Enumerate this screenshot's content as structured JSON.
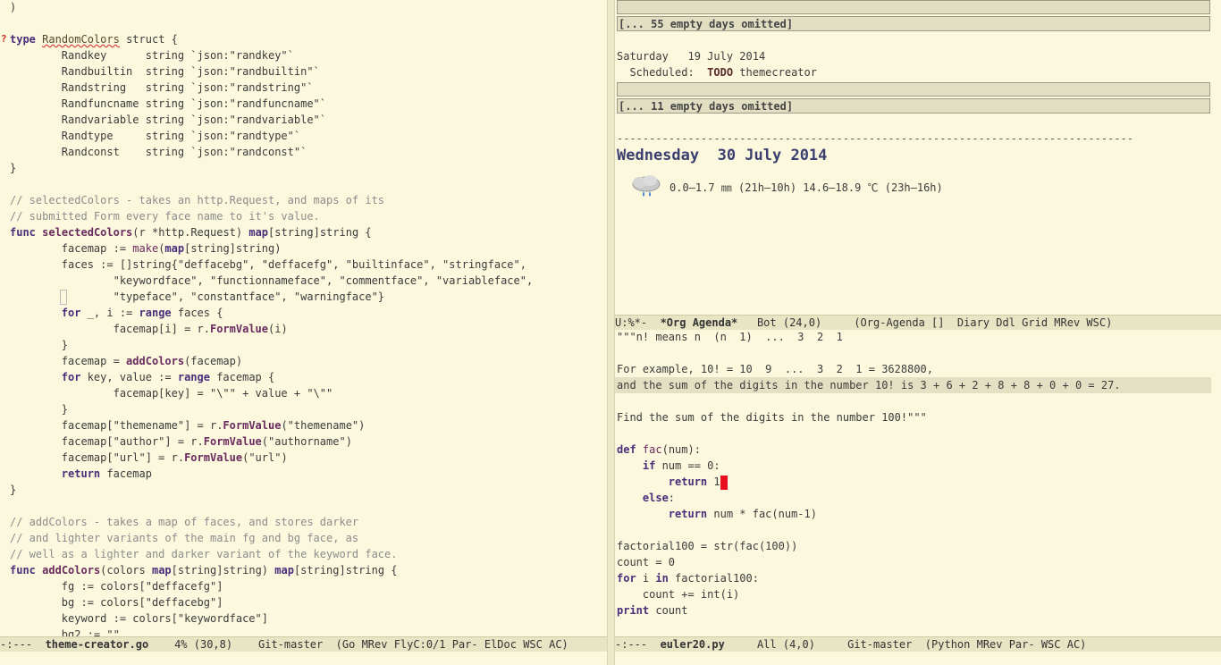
{
  "left": {
    "lines": [
      ")",
      "",
      "",
      "        Randkey      string `json:\"randkey\"`",
      "        Randbuiltin  string `json:\"randbuiltin\"`",
      "        Randstring   string `json:\"randstring\"`",
      "        Randfuncname string `json:\"randfuncname\"`",
      "        Randvariable string `json:\"randvariable\"`",
      "        Randtype     string `json:\"randtype\"`",
      "        Randconst    string `json:\"randconst\"`",
      "}",
      ""
    ],
    "struct_kw": "type",
    "struct_name": "RandomColors",
    "struct_rest": " struct {",
    "c1": "// selectedColors - takes an http.Request, and maps of its",
    "c2": "// submitted Form every face name to it's value.",
    "l_func1_kw": "func",
    "l_func1_name": "selectedColors",
    "l_func1_a": "(r *http.Request) ",
    "l_func1_map": "map",
    "l_func1_b": "[string]string {",
    "l_fm1_a": "        facemap := ",
    "l_fm1_make": "make",
    "l_fm1_b": "(",
    "l_fm1_map": "map",
    "l_fm1_c": "[string]string)",
    "l_faces1": "        faces := []string{\"deffacebg\", \"deffacefg\", \"builtinface\", \"stringface\",",
    "l_faces2": "                \"keywordface\", \"functionnameface\", \"commentface\", \"variableface\",",
    "l_faces3": "                \"typeface\", \"constantface\", \"warningface\"}",
    "l_for1_kw": "for",
    "l_for1_a": " _, i := ",
    "l_for1_range": "range",
    "l_for1_b": " faces {",
    "l_fmi_a": "                facemap[i] = r.",
    "l_fmi_fn": "FormValue",
    "l_fmi_b": "(i)",
    "l_close1": "        }",
    "l_fmadd_a": "        facemap = ",
    "l_fmadd_fn": "addColors",
    "l_fmadd_b": "(facemap)",
    "l_for2_kw": "for",
    "l_for2_a": " key, value := ",
    "l_for2_range": "range",
    "l_for2_b": " facemap {",
    "l_fmkey": "                facemap[key] = \"\\\"\" + value + \"\\\"\"",
    "l_close2": "        }",
    "l_theme_a": "        facemap[\"themename\"] = r.",
    "l_theme_fn": "FormValue",
    "l_theme_b": "(\"themename\")",
    "l_author_a": "        facemap[\"author\"] = r.",
    "l_author_fn": "FormValue",
    "l_author_b": "(\"authorname\")",
    "l_url_a": "        facemap[\"url\"] = r.",
    "l_url_fn": "FormValue",
    "l_url_b": "(\"url\")",
    "l_ret_kw": "return",
    "l_ret_b": " facemap",
    "l_close3": "}",
    "c3": "// addColors - takes a map of faces, and stores darker",
    "c4": "// and lighter variants of the main fg and bg face, as",
    "c5": "// well as a lighter and darker variant of the keyword face.",
    "l_func2_kw": "func",
    "l_func2_name": "addColors",
    "l_func2_a": "(colors ",
    "l_func2_map": "map",
    "l_func2_b": "[string]string) ",
    "l_func2_map2": "map",
    "l_func2_c": "[string]string {",
    "l_fg": "        fg := colors[\"deffacefg\"]",
    "l_bg": "        bg := colors[\"deffacebg\"]",
    "l_kw": "        keyword := colors[\"keywordface\"]",
    "l_bg2": "        bg2 := \"\""
  },
  "left_modeline": {
    "state": "-:---  ",
    "buffer": "theme-creator.go",
    "rest": "    4% (30,8)    Git-master  (Go MRev FlyC:0/1 Par- ElDoc WSC AC)"
  },
  "agenda": {
    "omit1": "[... 55 empty days omitted]",
    "sat": "Saturday   19 July 2014",
    "sched_a": "  Scheduled:  ",
    "sched_todo": "TODO",
    "sched_b": " themecreator",
    "omit2": "[... 11 empty days omitted]",
    "dashes": "--------------------------------------------------------------------------------",
    "wednesday": "Wednesday  30 July 2014",
    "weather": "0.0–1.7 ㎜ (21h–10h) 14.6–18.9 ℃ (23h–16h)",
    "weather_icon": "rain-cloud-icon"
  },
  "agenda_modeline": {
    "state": "U:%*-  ",
    "buffer": "*Org Agenda*",
    "rest": "   Bot (24,0)     (Org-Agenda []  Diary Ddl Grid MRev WSC)"
  },
  "python": {
    "p1": "\"\"\"n! means n  (n  1)  ...  3  2  1",
    "p2": "",
    "p3": "For example, 10! = 10  9  ...  3  2  1 = 3628800,",
    "p4": "and the sum of the digits in the number 10! is 3 + 6 + 2 + 8 + 8 + 0 + 0 = 27.",
    "p5": "",
    "p6": "Find the sum of the digits in the number 100!\"\"\"",
    "def_kw": "def",
    "def_name": "fac",
    "def_rest": "(num):",
    "if_kw": "    if",
    "if_rest": " num == 0:",
    "ret1_kw": "        return",
    "ret1_rest": " 1",
    "else_kw": "    else",
    "else_rest": ":",
    "ret2_kw": "        return",
    "ret2_rest": " num * fac(num-1)",
    "f100": "factorial100 = str(fac(100))",
    "count0": "count = 0",
    "for_kw": "for",
    "for_a": " i ",
    "for_in": "in",
    "for_b": " factorial100:",
    "count_inc": "    count += int(i)",
    "print_kw": "print",
    "print_rest": " count"
  },
  "python_modeline": {
    "state": "-:---  ",
    "buffer": "euler20.py",
    "rest": "     All (4,0)     Git-master  (Python MRev Par- WSC AC)"
  }
}
